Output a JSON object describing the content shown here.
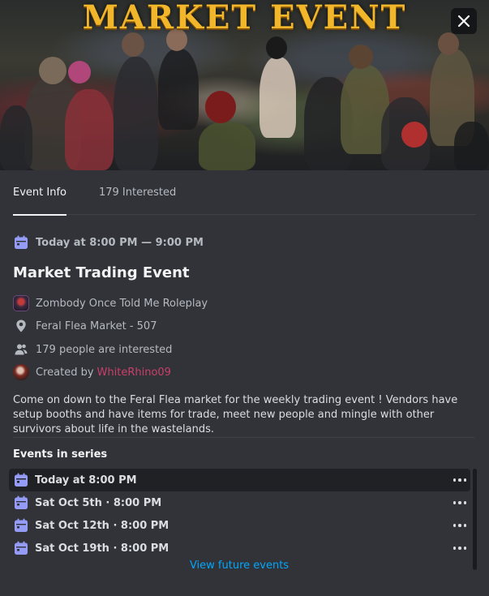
{
  "banner": {
    "title": "MARKET EVENT"
  },
  "close_icon": "close-icon",
  "tabs": [
    {
      "label": "Event Info",
      "active": true
    },
    {
      "label": "179 Interested",
      "active": false
    }
  ],
  "event": {
    "date_time": "Today at 8:00 PM — 9:00 PM",
    "title": "Market Trading Event",
    "server": "Zombody Once Told Me Roleplay",
    "location": "Feral Flea Market - 507",
    "interested": "179 people are interested",
    "created_by_prefix": "Created by",
    "creator": "WhiteRhino09",
    "description": "Come on down to the Feral Flea market for the weekly trading event ! Vendors have setup booths and have items for trade, meet new people and mingle with other survivors about life in the wastelands."
  },
  "series": {
    "heading": "Events in series",
    "items": [
      {
        "label": "Today at 8:00 PM",
        "selected": true
      },
      {
        "label": "Sat Oct 5th · 8:00 PM",
        "selected": false
      },
      {
        "label": "Sat Oct 12th · 8:00 PM",
        "selected": false
      },
      {
        "label": "Sat Oct 19th · 8:00 PM",
        "selected": false
      }
    ],
    "view_more": "View future events"
  },
  "colors": {
    "background": "#313338",
    "accent_icon": "#949cf7",
    "link": "#00a8fc",
    "creator": "#c93f6a",
    "banner_title": "#f2b62a"
  }
}
